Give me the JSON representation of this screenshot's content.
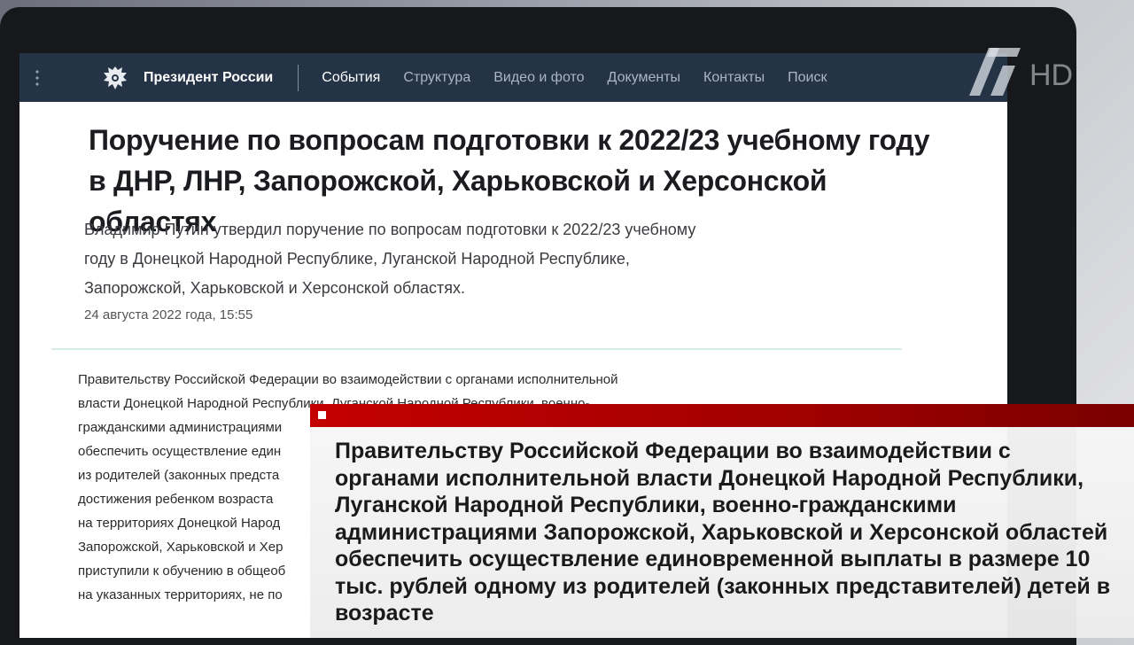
{
  "site": {
    "title": "Президент России",
    "nav": [
      "События",
      "Структура",
      "Видео и фото",
      "Документы",
      "Контакты",
      "Поиск"
    ]
  },
  "article": {
    "title": "Поручение по вопросам подготовки к 2022/23 учебному году в ДНР, ЛНР, Запорожской, Харьковской и Херсонской областях",
    "lead": "Владимир Путин утвердил поручение по вопросам подготовки к 2022/23 учебному году в Донецкой Народной Республике, Луганской Народной Республике, Запорожской, Харьковской и Херсонской областях.",
    "date": "24 августа 2022 года, 15:55",
    "body_lines": [
      "Правительству Российской Федерации во взаимодействии с органами исполнительной",
      "власти Донецкой Народной Республики, Луганской Народной Республики, военно-",
      "гражданскими администрациями",
      "обеспечить осуществление един",
      "из родителей (законных предста",
      "достижения ребенком возраста",
      "на территориях Донецкой Народ",
      "Запорожской, Харьковской и Хер",
      "приступили к обучению в общеоб",
      "на указанных территориях, не по"
    ]
  },
  "broadcast": {
    "logo_text": "HD",
    "caption": "Правительству Российской Федерации во взаимодействии с органами исполнительной власти Донецкой Народной Республики, Луганской Народной Республики, военно-гражданскими администрациями Запорожской, Харьковской и Херсонской областей обеспечить осуществление единовременной выплаты в размере 10 тыс. рублей одному из родителей (законных представителей) детей в возрасте"
  },
  "icons": {
    "menu": "menu-dots-icon",
    "emblem": "emblem-icon",
    "channel_logo": "channel-one-logo"
  },
  "colors": {
    "topbar": "#243446",
    "caption_bar": "#c40000",
    "rule": "#d6ece7"
  }
}
